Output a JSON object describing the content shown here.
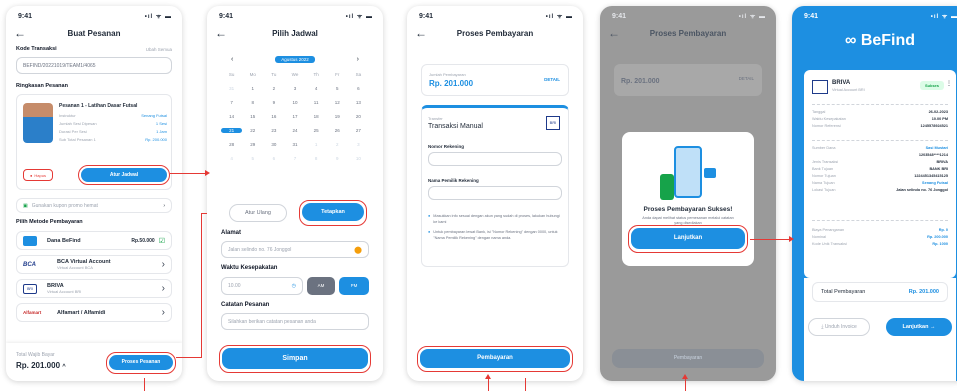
{
  "status_time": "9:41",
  "status_icons": "•ıl ᯤ ▬",
  "s1": {
    "title": "Buat Pesanan",
    "kode_label": "Kode Transaksi",
    "kode_action": "Ubah Semua",
    "kode_value": "BEFIND/20221019/TEAM1/4065",
    "ringkasan_label": "Ringkasan Pesanan",
    "pesanan_title": "Pesanan 1 - Latihan Dasar Futsal",
    "details": [
      {
        "k": "Instruktur",
        "v": "Senang Futsal"
      },
      {
        "k": "Jumlah Sesi Dipesan",
        "v": "1 Sesi"
      },
      {
        "k": "Durasi Per Sesi",
        "v": "1 Jam"
      },
      {
        "k": "Sub Total Pesanan 1",
        "v": "Rp. 200.000"
      }
    ],
    "hapus_label": "Hapus",
    "atur_jadwal": "Atur Jadwal",
    "kupon": "Gunakan kupon promo hemat",
    "metode_label": "Pilih Metode Pembayaran",
    "methods": [
      {
        "name": "Dana BeFind",
        "sub": "",
        "value": "Rp.50.000"
      },
      {
        "name": "BCA Virtual Account",
        "sub": "Virtual Account BCA",
        "value": ""
      },
      {
        "name": "BRIVA",
        "sub": "Virtual Account BRI",
        "value": ""
      },
      {
        "name": "Alfamart / Alfamidi",
        "sub": "",
        "value": ""
      }
    ],
    "logo_bca": "BCA",
    "logo_bri": "BRI",
    "logo_alfa": "Alfamart",
    "total_label": "Total Wajib Bayar",
    "total_value": "Rp. 201.000",
    "proses_button": "Proses Pesanan"
  },
  "s2": {
    "title": "Pilih Jadwal",
    "month": "Agustus 2022",
    "weekdays": [
      "Su",
      "Mo",
      "Tu",
      "We",
      "Th",
      "Fr",
      "Sa"
    ],
    "days": [
      "31",
      "1",
      "2",
      "3",
      "4",
      "5",
      "6",
      "7",
      "8",
      "9",
      "10",
      "11",
      "12",
      "13",
      "14",
      "15",
      "16",
      "17",
      "18",
      "19",
      "20",
      "21",
      "22",
      "23",
      "24",
      "25",
      "26",
      "27",
      "28",
      "29",
      "30",
      "31",
      "1",
      "2",
      "3",
      "4",
      "5",
      "6",
      "7",
      "8",
      "9",
      "10"
    ],
    "atur_ulang": "Atur Ulang",
    "tetapkan": "Tetapkan",
    "alamat_label": "Alamat",
    "alamat_placeholder": "Jalan selindo no. 76 Jonggol",
    "waktu_label": "Waktu Kesepakatan",
    "waktu_value": "10.00",
    "am": "AM",
    "pm": "PM",
    "catatan_label": "Catatan Pesanan",
    "catatan_placeholder": "Silahkan berikan catatan pesanan anda",
    "simpan": "Simpan"
  },
  "s3": {
    "title": "Proses Pembayaran",
    "jumlah_label": "Jumlah Pembayaran",
    "jumlah_value": "Rp. 201.000",
    "detail": "DETAIL",
    "transfer_label": "Transfer",
    "transfer_value": "Transaksi Manual",
    "bank_badge": "BRI",
    "rek_label": "Nomor Rekening",
    "pemilik_label": "Nama Pemilik Rekening",
    "notes": [
      "Masukkan info sesuai dengan akun yang sudah di proses, lakukan hubungi ke kami",
      "Untuk pembayaran lewat Bank, isi \"Nomor Rekening\" dengan 0000, untuk \"Nama Pemilik Rekening\" dengan nama anda."
    ],
    "pembayaran": "Pembayaran"
  },
  "s4": {
    "title": "Proses Pembayaran",
    "jumlah_value": "Rp. 201.000",
    "detail": "DETAIL",
    "modal_title": "Proses Pembayaran Sukses!",
    "modal_text": "Anda dapat melihat status pemesanan melalui catatan yang disediakan",
    "lanjutkan": "Lanjutkan",
    "pembayaran": "Pembayaran"
  },
  "s5": {
    "brand": "BeFind",
    "brand_logo": "∞",
    "bank": "BRIVA",
    "bank_sub": "Virtual Account BRI",
    "sukses": "Sukses",
    "rows1": [
      {
        "k": "Tanggal",
        "v": "26-02-2023"
      },
      {
        "k": "Waktu Kesepakatan",
        "v": "10.00 PM"
      },
      {
        "k": "Nomor Referensi",
        "v": "1245578924521"
      }
    ],
    "rows2": [
      {
        "k": "Sumber Dana",
        "v": "Sasi Mustari"
      },
      {
        "k": "",
        "v": "1203548****1214"
      },
      {
        "k": "Jenis Transaksi",
        "v": "BRIVA"
      },
      {
        "k": "Bank Tujuan",
        "v": "BANK BRI"
      },
      {
        "k": "Nomor Tujuan",
        "v": "1224451345415125"
      },
      {
        "k": "Nama Tujuan",
        "v": "Senang Futsal"
      },
      {
        "k": "Lokasi Tujuan",
        "v": "Jalan selindo no. 76 Jonggol"
      }
    ],
    "rows3": [
      {
        "k": "Biaya Penanganan",
        "v": "Rp. 0"
      },
      {
        "k": "Nominal",
        "v": "Rp. 200.000"
      },
      {
        "k": "Kode Unik Transaksi",
        "v": "Rp. 1000"
      }
    ],
    "total_label": "Total Pembayaran",
    "total_value": "Rp. 201.000",
    "unduh": "Unduh Invoice",
    "lanjutkan": "Lanjutkan"
  },
  "colors": {
    "accent": "#1d8fe1",
    "highlight": "#e53935",
    "success": "#16a34a",
    "overlay": "rgba(55,55,55,0.55)"
  }
}
